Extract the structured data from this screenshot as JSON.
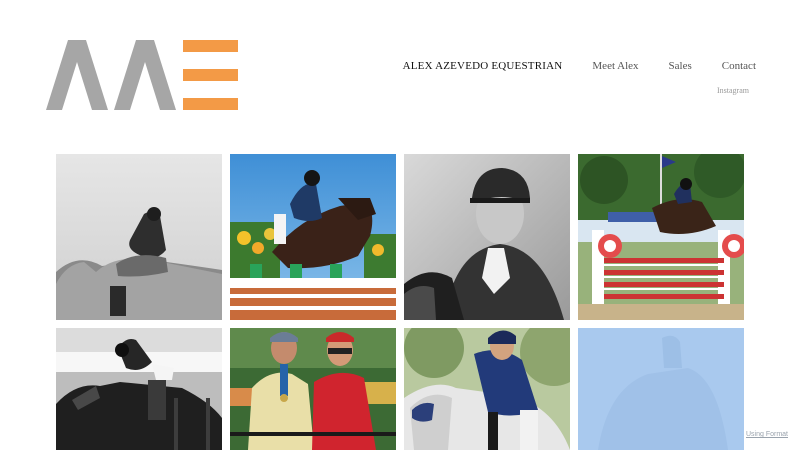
{
  "brand": {
    "logo_letters": "AAE",
    "logo_gray": "#a6a6a6",
    "logo_orange": "#f39a46"
  },
  "nav": {
    "items": [
      {
        "label": "ALEX AZEVEDO EQUESTRIAN"
      },
      {
        "label": "Meet Alex"
      },
      {
        "label": "Sales"
      },
      {
        "label": "Contact"
      }
    ],
    "sub_link": "Instagram"
  },
  "gallery": {
    "photos": [
      {
        "subject": "rider on grey horse, black and white"
      },
      {
        "subject": "horse jumping over flower-decorated fence"
      },
      {
        "subject": "rider in helmet, black and white close-up"
      },
      {
        "subject": "horse jumping in arena with flag"
      },
      {
        "subject": "horse and rider jumping, black and white"
      },
      {
        "subject": "two men with medal"
      },
      {
        "subject": "rider in blue jacket on grey horse"
      },
      {
        "subject": "faded blue horse photo"
      }
    ]
  },
  "footer": {
    "credit": "Using Format"
  }
}
